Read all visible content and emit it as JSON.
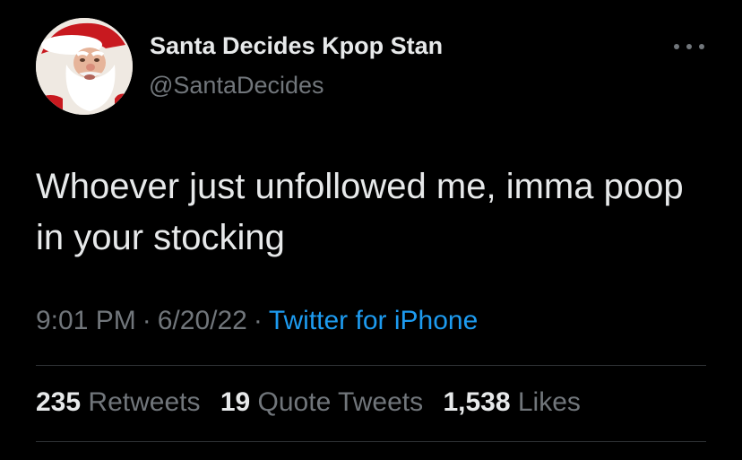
{
  "author": {
    "name": "Santa Decides Kpop Stan",
    "handle": "@SantaDecides",
    "avatar_icon": "santa-claus-avatar"
  },
  "tweet": {
    "text": "Whoever just unfollowed me, imma poop in your stocking",
    "time": "9:01 PM",
    "date": "6/20/22",
    "separator": "·",
    "source": "Twitter for iPhone"
  },
  "stats": {
    "retweets_count": "235",
    "retweets_label": "Retweets",
    "quotes_count": "19",
    "quotes_label": "Quote Tweets",
    "likes_count": "1,538",
    "likes_label": "Likes"
  },
  "colors": {
    "background": "#000000",
    "primary_text": "#e7e9ea",
    "secondary_text": "#71767b",
    "link": "#1d9bf0",
    "divider": "#2f3336"
  }
}
